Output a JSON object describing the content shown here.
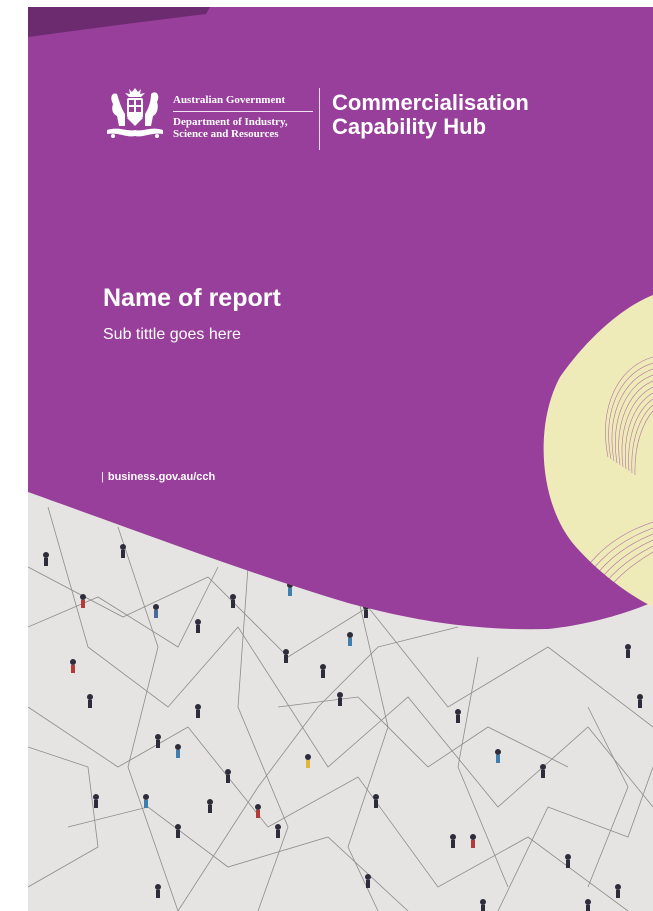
{
  "colors": {
    "brand_purple": "#973f9a",
    "dark_purple": "#6b2b6e",
    "accent_cream": "#efebb8",
    "pavement": "#e6e4e2"
  },
  "logo": {
    "crest_icon": "australian-coat-of-arms-icon",
    "government": "Australian Government",
    "department": "Department of Industry, Science and Resources",
    "hub_name_line1": "Commercialisation",
    "hub_name_line2": "Capability Hub"
  },
  "report": {
    "title": "Name of report",
    "subtitle": "Sub tittle goes here"
  },
  "footer": {
    "website": "business.gov.au/cch"
  },
  "image": {
    "subject": "aerial view of people walking on a plaza connected by network lines",
    "icon": "crowd-network-photo"
  }
}
